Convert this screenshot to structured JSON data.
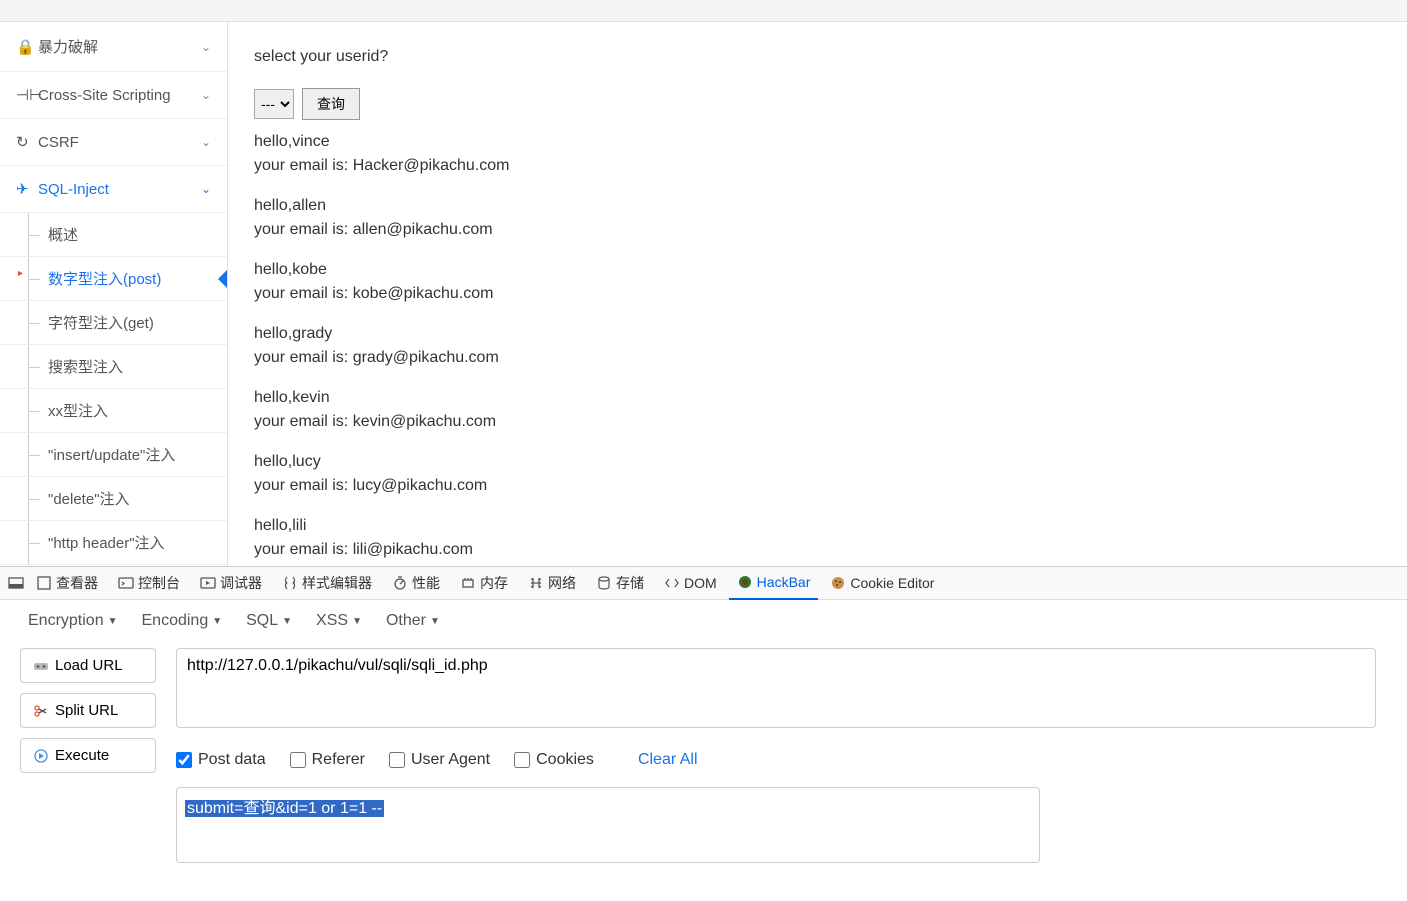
{
  "sidebar": {
    "items": [
      {
        "icon": "lock",
        "label": "暴力破解"
      },
      {
        "icon": "cs",
        "label": "Cross-Site Scripting"
      },
      {
        "icon": "refresh",
        "label": "CSRF"
      },
      {
        "icon": "plane",
        "label": "SQL-Inject",
        "active": true
      }
    ],
    "sub_items": [
      {
        "label": "概述"
      },
      {
        "label": "数字型注入(post)",
        "active": true
      },
      {
        "label": "字符型注入(get)"
      },
      {
        "label": "搜索型注入"
      },
      {
        "label": "xx型注入"
      },
      {
        "label": "\"insert/update\"注入"
      },
      {
        "label": "\"delete\"注入"
      },
      {
        "label": "\"http header\"注入"
      }
    ]
  },
  "content": {
    "prompt": "select your userid?",
    "select_placeholder": "---",
    "query_button": "查询",
    "results": [
      {
        "hello": "hello,vince",
        "email": "your email is: Hacker@pikachu.com"
      },
      {
        "hello": "hello,allen",
        "email": "your email is: allen@pikachu.com"
      },
      {
        "hello": "hello,kobe",
        "email": "your email is: kobe@pikachu.com"
      },
      {
        "hello": "hello,grady",
        "email": "your email is: grady@pikachu.com"
      },
      {
        "hello": "hello,kevin",
        "email": "your email is: kevin@pikachu.com"
      },
      {
        "hello": "hello,lucy",
        "email": "your email is: lucy@pikachu.com"
      },
      {
        "hello": "hello,lili",
        "email": "your email is: lili@pikachu.com"
      }
    ]
  },
  "devtools": {
    "tabs": [
      {
        "icon": "inspector",
        "label": "查看器"
      },
      {
        "icon": "console",
        "label": "控制台"
      },
      {
        "icon": "debugger",
        "label": "调试器"
      },
      {
        "icon": "style",
        "label": "样式编辑器"
      },
      {
        "icon": "perf",
        "label": "性能"
      },
      {
        "icon": "memory",
        "label": "内存"
      },
      {
        "icon": "network",
        "label": "网络"
      },
      {
        "icon": "storage",
        "label": "存储"
      },
      {
        "icon": "dom",
        "label": "DOM"
      },
      {
        "icon": "hackbar",
        "label": "HackBar",
        "active": true
      },
      {
        "icon": "cookie",
        "label": "Cookie Editor"
      }
    ]
  },
  "hackbar": {
    "menu": [
      "Encryption",
      "Encoding",
      "SQL",
      "XSS",
      "Other"
    ],
    "buttons": {
      "load_url": "Load URL",
      "split_url": "Split URL",
      "execute": "Execute"
    },
    "url": "http://127.0.0.1/pikachu/vul/sqli/sqli_id.php",
    "checks": {
      "post_data": "Post data",
      "referer": "Referer",
      "user_agent": "User Agent",
      "cookies": "Cookies"
    },
    "clear_all": "Clear All",
    "post_body": "submit=查询&id=1 or 1=1 --"
  }
}
